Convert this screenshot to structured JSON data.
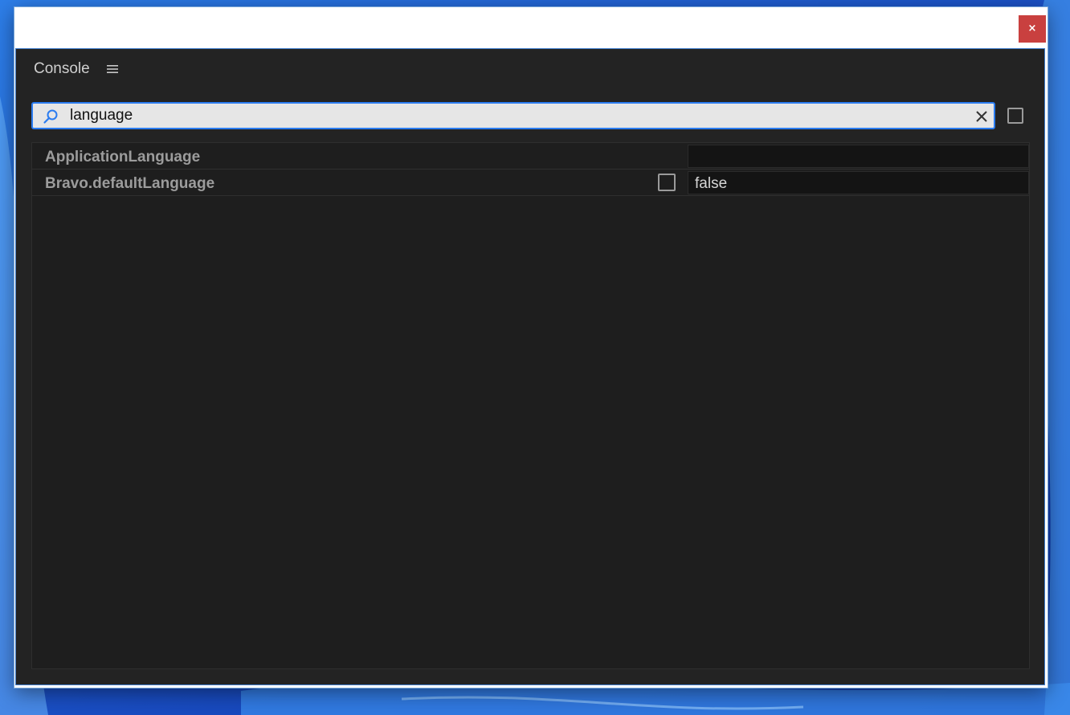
{
  "window": {
    "close_label": "×"
  },
  "panel": {
    "title": "Console",
    "menu_icon": "hamburger-menu-icon"
  },
  "search": {
    "value": "language",
    "search_icon": "search-icon",
    "clear_icon": "clear-icon",
    "option_checked": false
  },
  "rows": [
    {
      "label": "ApplicationLanguage",
      "value": "",
      "has_checkbox": false
    },
    {
      "label": "Bravo.defaultLanguage",
      "value": "false",
      "has_checkbox": true,
      "checked": false
    }
  ],
  "colors": {
    "accent": "#2b7cf0",
    "close_button": "#c9403f",
    "panel_bg": "#232323"
  }
}
